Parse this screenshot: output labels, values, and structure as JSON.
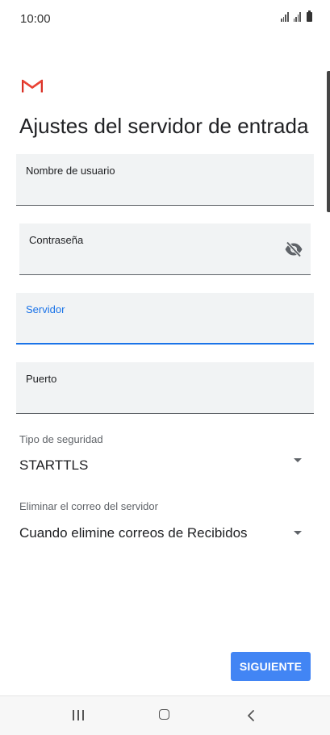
{
  "status_bar": {
    "time": "10:00"
  },
  "app": {
    "logo_icon": "gmail-icon",
    "title": "Ajustes del servidor de entrada"
  },
  "form": {
    "username": {
      "label": "Nombre de usuario",
      "value": ""
    },
    "password": {
      "label": "Contraseña",
      "value": "",
      "toggle_icon": "visibility-off-icon"
    },
    "server": {
      "label": "Servidor",
      "value": "",
      "focused": true
    },
    "port": {
      "label": "Puerto",
      "value": ""
    },
    "security_type": {
      "label": "Tipo de seguridad",
      "value": "STARTTLS"
    },
    "delete_from_server": {
      "label": "Eliminar el correo del servidor",
      "value": "Cuando elimine correos de Recibidos"
    }
  },
  "actions": {
    "next_label": "SIGUIENTE"
  },
  "colors": {
    "accent": "#1a73e8",
    "button": "#4285f4",
    "field_bg": "#f1f3f4"
  }
}
